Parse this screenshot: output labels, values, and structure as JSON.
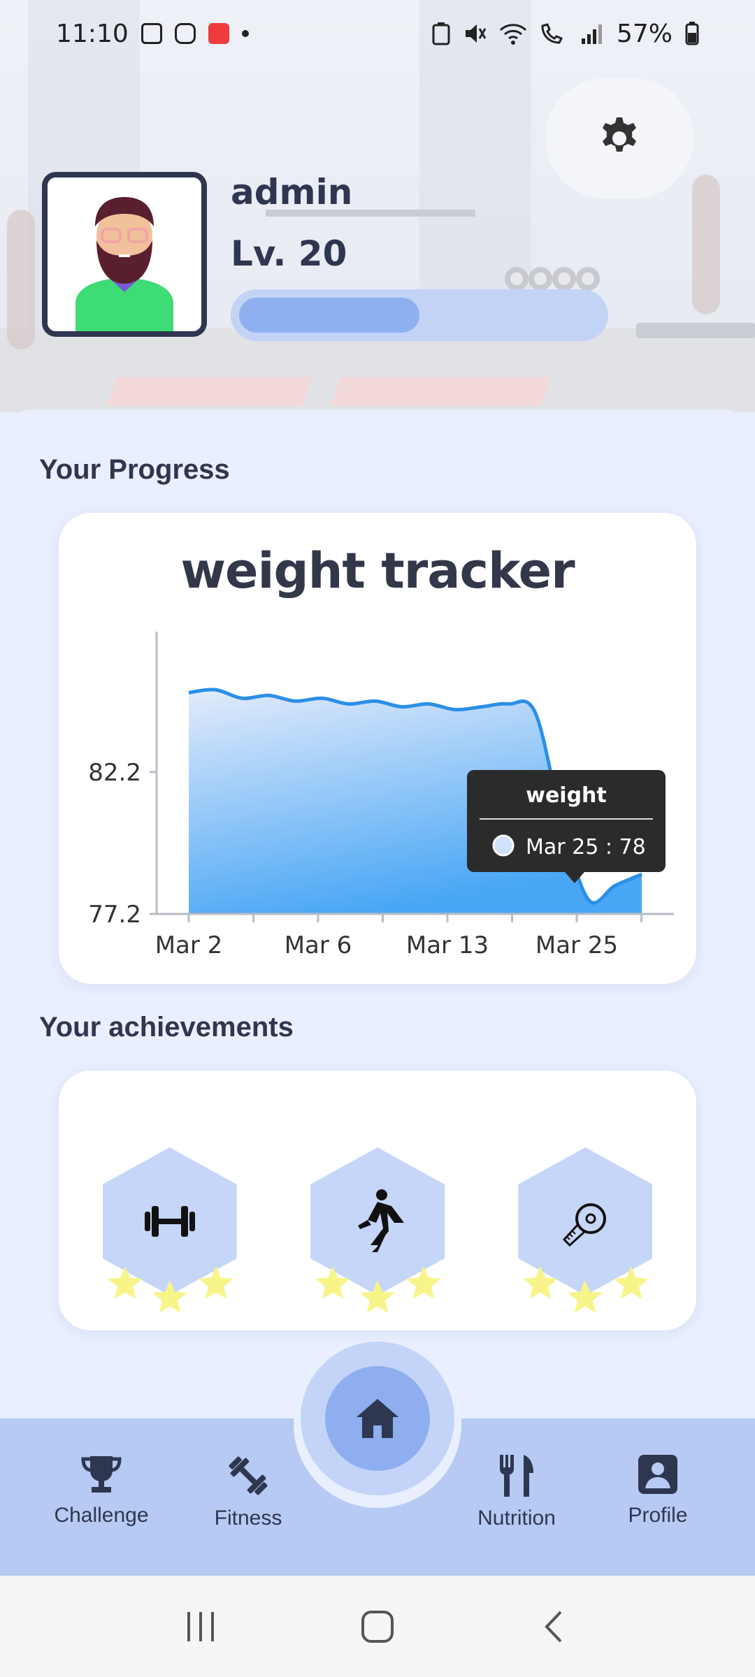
{
  "status_bar": {
    "time": "11:10",
    "battery": "57%",
    "icons": [
      "image-icon",
      "instagram-icon",
      "blocked-notification-icon",
      "dot-icon",
      "battery-saver-icon",
      "mute-icon",
      "wifi-icon",
      "wifi-calling-icon",
      "signal-icon",
      "battery-icon"
    ]
  },
  "profile": {
    "username": "admin",
    "level_label": "Lv. 20",
    "xp_progress_fraction": 0.5
  },
  "sections": {
    "progress_title": "Your Progress",
    "achievements_title": "Your achievements"
  },
  "chart_data": {
    "type": "area",
    "title": "weight tracker",
    "xlabel": "",
    "ylabel": "",
    "x_ticks": [
      "Mar 2",
      "Mar 6",
      "Mar 13",
      "Mar 25"
    ],
    "y_ticks": [
      "82.2",
      "77.2"
    ],
    "ylim": [
      77.2,
      86.9
    ],
    "series": [
      {
        "name": "weight",
        "values": [
          85.0,
          85.1,
          84.8,
          84.9,
          84.7,
          84.8,
          84.6,
          84.7,
          84.5,
          84.6,
          84.4,
          84.5,
          84.6,
          84.3,
          80.5,
          77.7,
          78.2,
          78.6
        ]
      }
    ],
    "tooltip": {
      "title": "weight",
      "label": "Mar 25 : 78"
    },
    "colors": {
      "line": "#2b8fe6",
      "fill_top": "#e3ebfb",
      "fill_bottom": "#4aa7f5"
    }
  },
  "achievements": [
    {
      "icon": "dumbbell-icon",
      "stars": 3
    },
    {
      "icon": "runner-icon",
      "stars": 3
    },
    {
      "icon": "measuring-tape-icon",
      "stars": 3
    }
  ],
  "nav": {
    "items": [
      {
        "label": "Challenge",
        "icon": "trophy-icon"
      },
      {
        "label": "Fitness",
        "icon": "dumbbell-icon"
      },
      {
        "label": "Nutrition",
        "icon": "fork-knife-icon"
      },
      {
        "label": "Profile",
        "icon": "profile-icon"
      }
    ],
    "home_icon": "home-icon"
  },
  "colors": {
    "accent": "#8eaef0",
    "nav_bg": "#b7caf3",
    "text_dark": "#2f3650",
    "page_bg": "#e9efff",
    "star": "#f7f58a"
  }
}
